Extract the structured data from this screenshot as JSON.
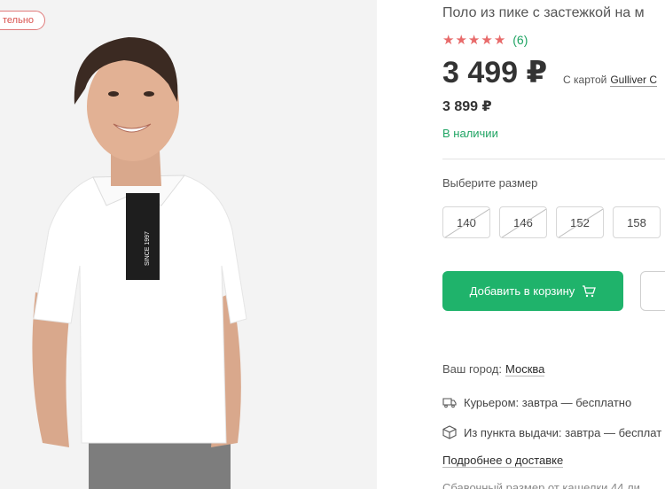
{
  "photo": {
    "badge": "тельно",
    "shirt_print": "SINCE 1997"
  },
  "product": {
    "title": "Поло из пике с застежкой на м",
    "rating_stars": 5,
    "reviews": "(6)",
    "price": "3 499 ₽",
    "card_note_prefix": "С картой",
    "card_link": "Gulliver C",
    "old_price": "3 899 ₽",
    "stock": "В наличии"
  },
  "sizes": {
    "label": "Выберите размер",
    "options": [
      "140",
      "146",
      "152",
      "158"
    ]
  },
  "actions": {
    "add_to_cart": "Добавить в корзину"
  },
  "delivery": {
    "city_label": "Ваш город:",
    "city": "Москва",
    "courier": "Курьером: завтра — бесплатно",
    "pickup": "Из пункта выдачи: завтра — бесплат",
    "more": "Подробнее о доставке",
    "cutoff": "Сбавочный размер от кашелки 44 ли"
  },
  "colors": {
    "accent_green": "#1fb36b",
    "star_red": "#e86a6a"
  }
}
